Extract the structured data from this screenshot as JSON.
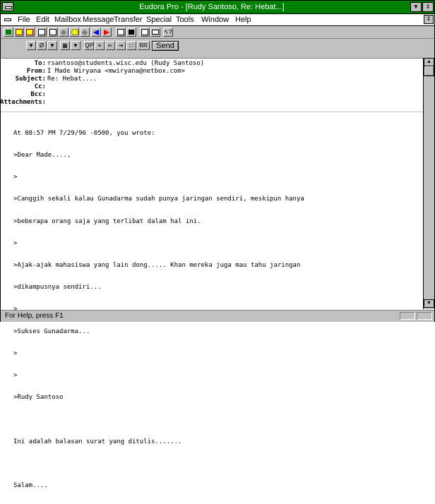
{
  "window": {
    "title": "Eudora Pro - [Rudy Santoso, Re: Hebat...]",
    "title_bar_color": "#008000"
  },
  "menubar": {
    "items": [
      {
        "label": "File"
      },
      {
        "label": "Edit"
      },
      {
        "label": "Mailbox"
      },
      {
        "label": "Message"
      },
      {
        "label": "Transfer"
      },
      {
        "label": "Special"
      },
      {
        "label": "Tools"
      },
      {
        "label": "Window"
      },
      {
        "label": "Help"
      }
    ]
  },
  "toolbar": {
    "send_label": "Send"
  },
  "headers": {
    "to_label": "To:",
    "to_value": "rsantoso@students.wisc.edu (Rudy Santoso)",
    "from_label": "From:",
    "from_value": "I Made Wiryana <mwiryana@netbox.com>",
    "subject_label": "Subject:",
    "subject_value": "Re: Hebat....",
    "cc_label": "Cc:",
    "cc_value": "",
    "bcc_label": "Bcc:",
    "bcc_value": "",
    "attachments_label": "Attachments:",
    "attachments_value": ""
  },
  "body": {
    "lines": [
      "At 08:57 PM 7/29/96 -0500, you wrote:",
      ">Dear Made....,",
      ">",
      ">Canggih sekali kalau Gunadarma sudah punya jaringan sendiri, meskipun hanya",
      ">beberapa orang saja yang terlibat dalam hal ini.",
      ">",
      ">Ajak-ajak mahasiswa yang lain dong..... Khan mereka juga mau tahu jaringan",
      ">dikampusnya sendiri...",
      ">",
      ">Sukses Gunadarma...",
      ">",
      ">",
      ">Rudy Santoso",
      "",
      "Ini adalah balasan surat yang ditulis.......",
      "",
      "Salam...."
    ]
  },
  "status": {
    "text": "For Help, press F1"
  }
}
